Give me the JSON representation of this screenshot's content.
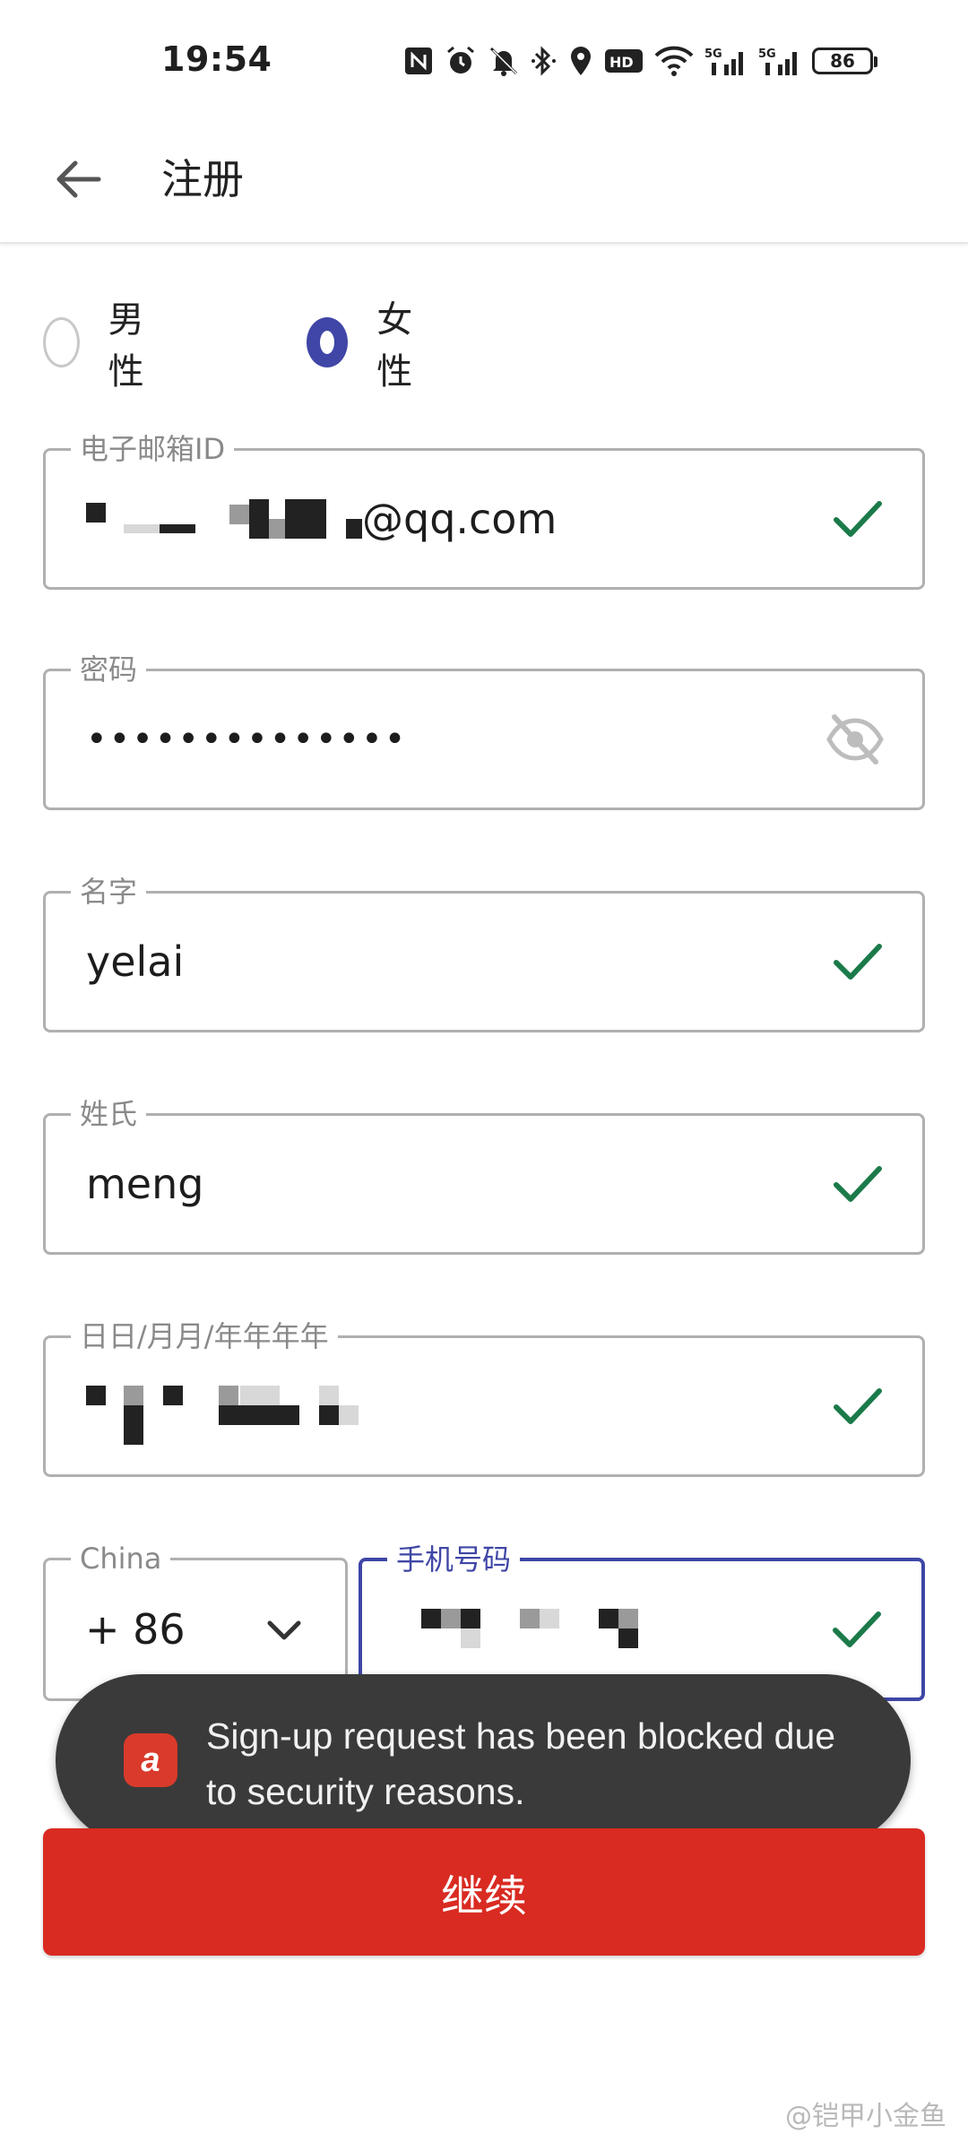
{
  "status_bar": {
    "time": "19:54",
    "battery": "86",
    "icons": [
      "nfc-icon",
      "alarm-icon",
      "mute-bell-icon",
      "bluetooth-icon",
      "location-icon",
      "hd-icon",
      "wifi-icon",
      "5g-signal-icon",
      "5g-signal-icon"
    ]
  },
  "app_bar": {
    "title": "注册"
  },
  "gender": {
    "options": [
      {
        "label": "男性",
        "selected": false
      },
      {
        "label": "女性",
        "selected": true
      }
    ]
  },
  "form": {
    "email": {
      "label": "电子邮箱ID",
      "value_suffix": "@qq.com",
      "valid": true
    },
    "password": {
      "label": "密码",
      "value": "••••••••••••••"
    },
    "first_name": {
      "label": "名字",
      "value": "yelai",
      "valid": true
    },
    "last_name": {
      "label": "姓氏",
      "value": "meng",
      "valid": true
    },
    "dob": {
      "label": "日日/月月/年年年年",
      "valid": true
    },
    "country": {
      "label": "China",
      "value": "+ 86"
    },
    "phone": {
      "label": "手机号码",
      "valid": true
    }
  },
  "snackbar": {
    "message": "Sign-up request has been blocked due to security reasons."
  },
  "continue_button": {
    "label": "继续"
  },
  "watermark": "@铠甲小金鱼",
  "colors": {
    "accent": "#3f46a6",
    "primary_button": "#d92b22",
    "check": "#1b7a4a",
    "snackbar": "#3a3a3a"
  }
}
